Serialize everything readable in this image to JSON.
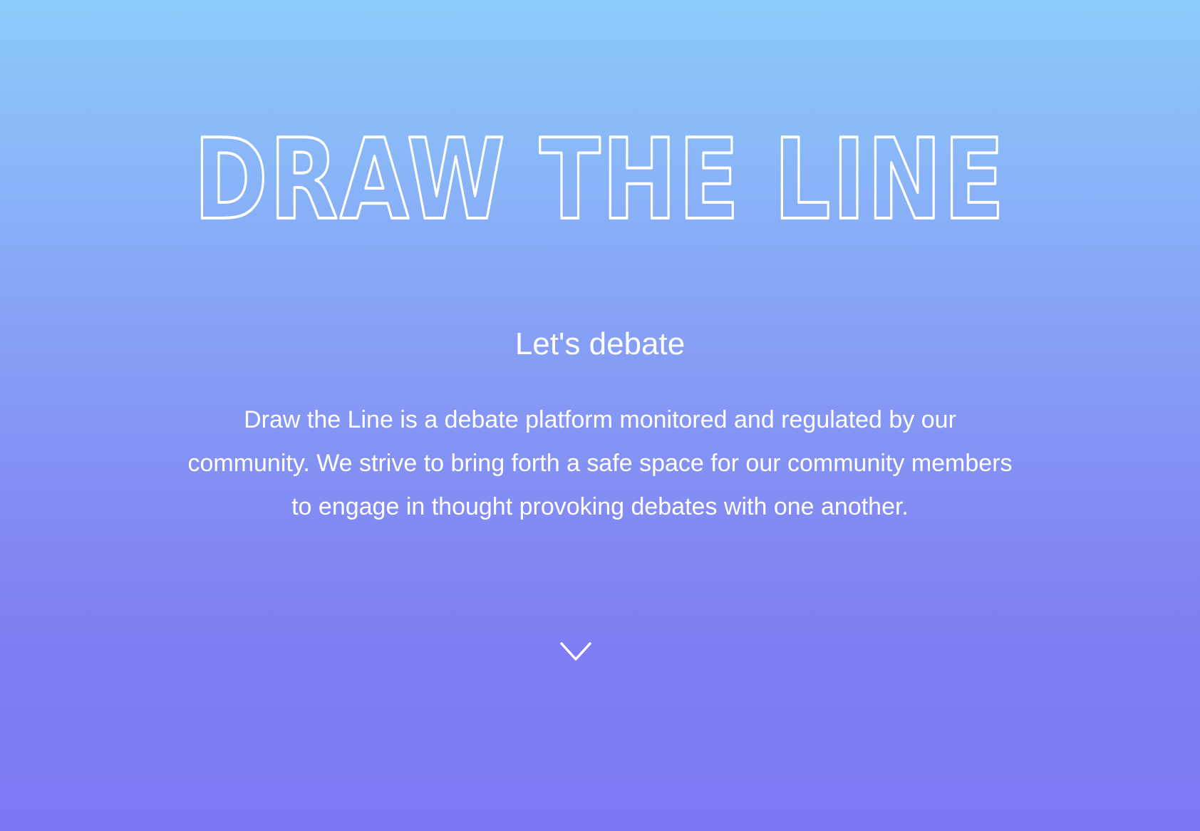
{
  "hero": {
    "title": "DRAW THE LINE",
    "tagline": "Let's debate",
    "description": "Draw the Line is a debate platform monitored and regulated by our community. We strive to bring forth a safe space for our community members to engage in thought provoking debates with one another.",
    "scroll_icon": "chevron-down-icon"
  },
  "colors": {
    "gradient_top": "#8ccbfa",
    "gradient_bottom": "#7d78f2",
    "text": "#ffffff"
  }
}
